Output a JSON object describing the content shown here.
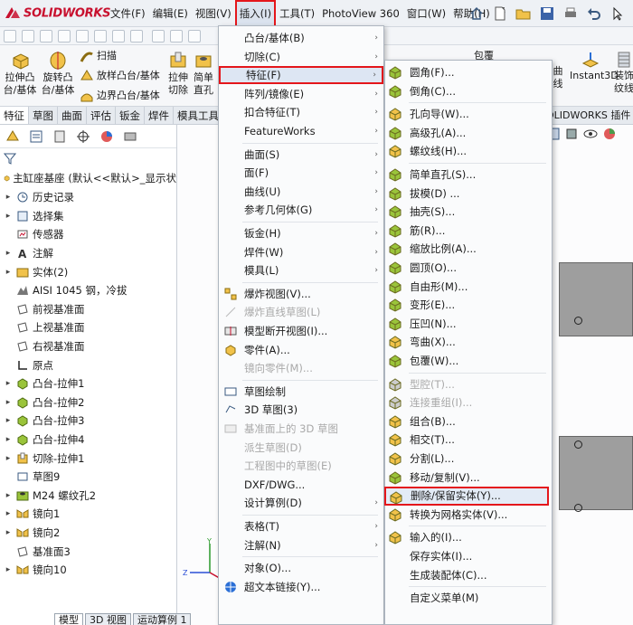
{
  "app": {
    "logo_text": "SOLIDWORKS",
    "brand_color": "#c8102e",
    "highlight_color": "#e4161b"
  },
  "menubar": {
    "items": [
      "文件(F)",
      "编辑(E)",
      "视图(V)",
      "插入(I)",
      "工具(T)",
      "PhotoView 360",
      "窗口(W)",
      "帮助(H)"
    ],
    "pin_icon": "pin-icon"
  },
  "ribbon": {
    "extrude_boss": "拉伸凸\n台/基体",
    "revolve_boss": "旋转凸\n台/基体",
    "sweep": "扫描",
    "loft_boss": "放样凸台/基体",
    "boundary_boss": "边界凸台/基体",
    "extrude_cut": "拉伸\n切除",
    "hole": "简单\n直孔",
    "wrap": "包覆",
    "instant3d": "Instant3D",
    "cosmetic": "装饰\n纹线",
    "curves": "曲\n线"
  },
  "tabs": {
    "items": [
      "特征",
      "草图",
      "曲面",
      "评估",
      "钣金",
      "焊件",
      "模具工具"
    ],
    "right_label": "OLIDWORKS 插件"
  },
  "tree": {
    "root": "主缸座基座 (默认<<默认>_显示状",
    "items": [
      {
        "label": "历史记录",
        "icon": "history-icon",
        "exp": "▸"
      },
      {
        "label": "选择集",
        "icon": "selection-set-icon",
        "exp": "▸"
      },
      {
        "label": "传感器",
        "icon": "sensor-icon",
        "exp": ""
      },
      {
        "label": "注解",
        "icon": "annotation-icon",
        "exp": "▸"
      },
      {
        "label": "实体(2)",
        "icon": "solid-bodies-icon",
        "exp": "▸"
      },
      {
        "label": "AISI 1045 钢，冷拔",
        "icon": "material-icon",
        "exp": ""
      },
      {
        "label": "前视基准面",
        "icon": "plane-icon",
        "exp": ""
      },
      {
        "label": "上视基准面",
        "icon": "plane-icon",
        "exp": ""
      },
      {
        "label": "右视基准面",
        "icon": "plane-icon",
        "exp": ""
      },
      {
        "label": "原点",
        "icon": "origin-icon",
        "exp": ""
      },
      {
        "label": "凸台-拉伸1",
        "icon": "boss-extrude-icon",
        "exp": "▸"
      },
      {
        "label": "凸台-拉伸2",
        "icon": "boss-extrude-icon",
        "exp": "▸"
      },
      {
        "label": "凸台-拉伸3",
        "icon": "boss-extrude-icon",
        "exp": "▸"
      },
      {
        "label": "凸台-拉伸4",
        "icon": "boss-extrude-icon",
        "exp": "▸"
      },
      {
        "label": "切除-拉伸1",
        "icon": "cut-extrude-icon",
        "exp": "▸"
      },
      {
        "label": "草图9",
        "icon": "sketch-icon",
        "exp": ""
      },
      {
        "label": "M24 螺纹孔2",
        "icon": "hole-wizard-icon",
        "exp": "▸"
      },
      {
        "label": "镜向1",
        "icon": "mirror-icon",
        "exp": "▸"
      },
      {
        "label": "镜向2",
        "icon": "mirror-icon",
        "exp": "▸"
      },
      {
        "label": "基准面3",
        "icon": "plane-icon",
        "exp": ""
      },
      {
        "label": "镜向10",
        "icon": "mirror-icon",
        "exp": "▸"
      }
    ]
  },
  "bottom_tabs": [
    "模型",
    "3D 视图",
    "运动算例 1"
  ],
  "insert_menu": {
    "items": [
      {
        "label": "凸台/基体(B)",
        "arrow": "›",
        "dis": false,
        "icon": ""
      },
      {
        "label": "切除(C)",
        "arrow": "›",
        "dis": false,
        "icon": ""
      },
      {
        "label": "特征(F)",
        "arrow": "›",
        "dis": false,
        "icon": "",
        "hl": true
      },
      {
        "label": "阵列/镜像(E)",
        "arrow": "›",
        "dis": false,
        "icon": ""
      },
      {
        "label": "扣合特征(T)",
        "arrow": "›",
        "dis": false,
        "icon": ""
      },
      {
        "label": "FeatureWorks",
        "arrow": "›",
        "dis": false,
        "icon": ""
      },
      {
        "sep": true
      },
      {
        "label": "曲面(S)",
        "arrow": "›",
        "dis": false,
        "icon": ""
      },
      {
        "label": "面(F)",
        "arrow": "›",
        "dis": false,
        "icon": ""
      },
      {
        "label": "曲线(U)",
        "arrow": "›",
        "dis": false,
        "icon": ""
      },
      {
        "label": "参考几何体(G)",
        "arrow": "›",
        "dis": false,
        "icon": ""
      },
      {
        "sep": true
      },
      {
        "label": "钣金(H)",
        "arrow": "›",
        "dis": false,
        "icon": ""
      },
      {
        "label": "焊件(W)",
        "arrow": "›",
        "dis": false,
        "icon": ""
      },
      {
        "label": "模具(L)",
        "arrow": "›",
        "dis": false,
        "icon": ""
      },
      {
        "sep": true
      },
      {
        "label": "爆炸视图(V)...",
        "arrow": "",
        "dis": false,
        "icon": "explode-icon"
      },
      {
        "label": "爆炸直线草图(L)",
        "arrow": "",
        "dis": true,
        "icon": "explode-line-icon"
      },
      {
        "label": "模型断开视图(I)...",
        "arrow": "",
        "dis": false,
        "icon": "break-view-icon"
      },
      {
        "label": "零件(A)...",
        "arrow": "",
        "dis": false,
        "icon": "part-icon"
      },
      {
        "label": "镜向零件(M)...",
        "arrow": "",
        "dis": true,
        "icon": ""
      },
      {
        "sep": true
      },
      {
        "label": "草图绘制",
        "arrow": "",
        "dis": false,
        "icon": "sketch-icon"
      },
      {
        "label": "3D 草图(3)",
        "arrow": "",
        "dis": false,
        "icon": "3d-sketch-icon"
      },
      {
        "label": "基准面上的 3D 草图",
        "arrow": "",
        "dis": true,
        "icon": "3d-sketch-plane-icon"
      },
      {
        "label": "派生草图(D)",
        "arrow": "",
        "dis": true,
        "icon": ""
      },
      {
        "label": "工程图中的草图(E)",
        "arrow": "",
        "dis": true,
        "icon": ""
      },
      {
        "label": "DXF/DWG...",
        "arrow": "",
        "dis": false,
        "icon": ""
      },
      {
        "label": "设计算例(D)",
        "arrow": "›",
        "dis": false,
        "icon": ""
      },
      {
        "sep": true
      },
      {
        "label": "表格(T)",
        "arrow": "›",
        "dis": false,
        "icon": ""
      },
      {
        "label": "注解(N)",
        "arrow": "›",
        "dis": false,
        "icon": ""
      },
      {
        "sep": true
      },
      {
        "label": "对象(O)...",
        "arrow": "",
        "dis": false,
        "icon": ""
      },
      {
        "label": "超文本链接(Y)...",
        "arrow": "",
        "dis": false,
        "icon": "hyperlink-icon"
      }
    ]
  },
  "feature_submenu": {
    "items": [
      {
        "label": "圆角(F)...",
        "dis": false,
        "icon": "fillet-icon"
      },
      {
        "label": "倒角(C)...",
        "dis": false,
        "icon": "chamfer-icon"
      },
      {
        "sep": true
      },
      {
        "label": "孔向导(W)...",
        "dis": false,
        "icon": "hole-wizard-icon"
      },
      {
        "label": "高级孔(A)...",
        "dis": false,
        "icon": "advanced-hole-icon"
      },
      {
        "label": "螺纹线(H)...",
        "dis": false,
        "icon": "thread-icon"
      },
      {
        "sep": true
      },
      {
        "label": "简单直孔(S)...",
        "dis": false,
        "icon": "simple-hole-icon"
      },
      {
        "label": "拔模(D) ...",
        "dis": false,
        "icon": "draft-icon"
      },
      {
        "label": "抽壳(S)...",
        "dis": false,
        "icon": "shell-icon"
      },
      {
        "label": "筋(R)...",
        "dis": false,
        "icon": "rib-icon"
      },
      {
        "label": "缩放比例(A)...",
        "dis": false,
        "icon": "scale-icon"
      },
      {
        "label": "圆顶(O)...",
        "dis": false,
        "icon": "dome-icon"
      },
      {
        "label": "自由形(M)...",
        "dis": false,
        "icon": "freeform-icon"
      },
      {
        "label": "变形(E)...",
        "dis": false,
        "icon": "deform-icon"
      },
      {
        "label": "压凹(N)...",
        "dis": false,
        "icon": "indent-icon"
      },
      {
        "label": "弯曲(X)...",
        "dis": false,
        "icon": "flex-icon"
      },
      {
        "label": "包覆(W)...",
        "dis": false,
        "icon": "wrap-icon"
      },
      {
        "sep": true
      },
      {
        "label": "型腔(T)...",
        "dis": true,
        "icon": "cavity-icon"
      },
      {
        "label": "连接重组(I)...",
        "dis": true,
        "icon": "join-icon"
      },
      {
        "label": "组合(B)...",
        "dis": false,
        "icon": "combine-icon"
      },
      {
        "label": "相交(T)...",
        "dis": false,
        "icon": "intersect-icon"
      },
      {
        "label": "分割(L)...",
        "dis": false,
        "icon": "split-icon"
      },
      {
        "label": "移动/复制(V)...",
        "dis": false,
        "icon": "move-copy-icon"
      },
      {
        "label": "删除/保留实体(Y)...",
        "dis": false,
        "icon": "delete-body-icon",
        "hl": true
      },
      {
        "label": "转换为网格实体(V)...",
        "dis": false,
        "icon": "convert-mesh-icon"
      },
      {
        "sep": true
      },
      {
        "label": "输入的(I)...",
        "dis": false,
        "icon": "imported-icon"
      },
      {
        "label": "保存实体(I)...",
        "dis": false,
        "icon": ""
      },
      {
        "label": "生成装配体(C)...",
        "dis": false,
        "icon": ""
      },
      {
        "sep": true
      },
      {
        "label": "自定义菜单(M)",
        "dis": false,
        "icon": ""
      }
    ]
  }
}
